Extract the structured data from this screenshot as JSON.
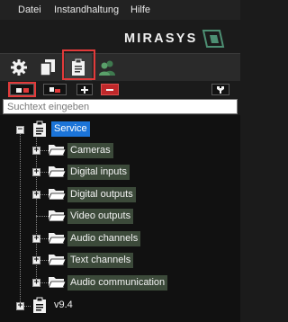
{
  "menu": {
    "items": [
      "Datei",
      "Instandhaltung",
      "Hilfe"
    ]
  },
  "brand": {
    "name": "MIRASYS",
    "accent": "#4d8f73"
  },
  "tabs": [
    {
      "icon": "gear-icon",
      "active": false
    },
    {
      "icon": "documents-icon",
      "active": false
    },
    {
      "icon": "clipboard-icon",
      "active": true
    },
    {
      "icon": "users-icon",
      "active": false
    }
  ],
  "toolbar": {
    "buttons": [
      "expand-view-icon",
      "collapse-view-icon",
      "plus-icon",
      "minus-icon",
      "wrench-icon"
    ]
  },
  "search": {
    "placeholder": "Suchtext eingeben",
    "value": ""
  },
  "tree": {
    "root": "Service",
    "children": [
      {
        "label": "Cameras",
        "expandable": true
      },
      {
        "label": "Digital inputs",
        "expandable": true
      },
      {
        "label": "Digital outputs",
        "expandable": true
      },
      {
        "label": "Video outputs",
        "expandable": false
      },
      {
        "label": "Audio channels",
        "expandable": true
      },
      {
        "label": "Text channels",
        "expandable": true
      },
      {
        "label": "Audio communication",
        "expandable": true
      }
    ],
    "sibling": "v9.4"
  },
  "colors": {
    "highlight": "#e23a3a",
    "selection": "#1b74d8",
    "node_bg": "#3c4a3a"
  }
}
